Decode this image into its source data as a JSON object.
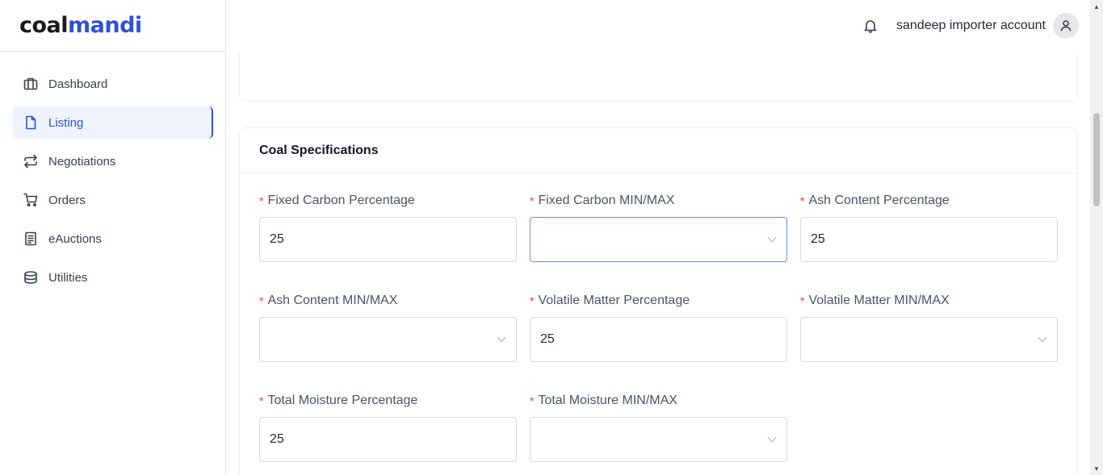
{
  "brand": {
    "logo_part1": "coal",
    "logo_part2": "mandi",
    "accent": "#2d52d6"
  },
  "sidebar": {
    "items": [
      {
        "label": "Dashboard",
        "icon": "briefcase-icon",
        "active": false
      },
      {
        "label": "Listing",
        "icon": "document-icon",
        "active": true
      },
      {
        "label": "Negotiations",
        "icon": "swap-arrows-icon",
        "active": false
      },
      {
        "label": "Orders",
        "icon": "cart-icon",
        "active": false
      },
      {
        "label": "eAuctions",
        "icon": "list-document-icon",
        "active": false
      },
      {
        "label": "Utilities",
        "icon": "database-icon",
        "active": false
      }
    ]
  },
  "header": {
    "user_name": "sandeep importer account"
  },
  "section": {
    "title": "Coal Specifications",
    "required_mark": "*",
    "fields": [
      {
        "label": "Fixed Carbon Percentage",
        "type": "input",
        "value": "25"
      },
      {
        "label": "Fixed Carbon MIN/MAX",
        "type": "select",
        "value": ""
      },
      {
        "label": "Ash Content Percentage",
        "type": "input",
        "value": "25"
      },
      {
        "label": "Ash Content MIN/MAX",
        "type": "select",
        "value": ""
      },
      {
        "label": "Volatile Matter Percentage",
        "type": "input",
        "value": "25"
      },
      {
        "label": "Volatile Matter MIN/MAX",
        "type": "select",
        "value": ""
      },
      {
        "label": "Total Moisture Percentage",
        "type": "input",
        "value": "25"
      },
      {
        "label": "Total Moisture MIN/MAX",
        "type": "select",
        "value": ""
      }
    ]
  }
}
